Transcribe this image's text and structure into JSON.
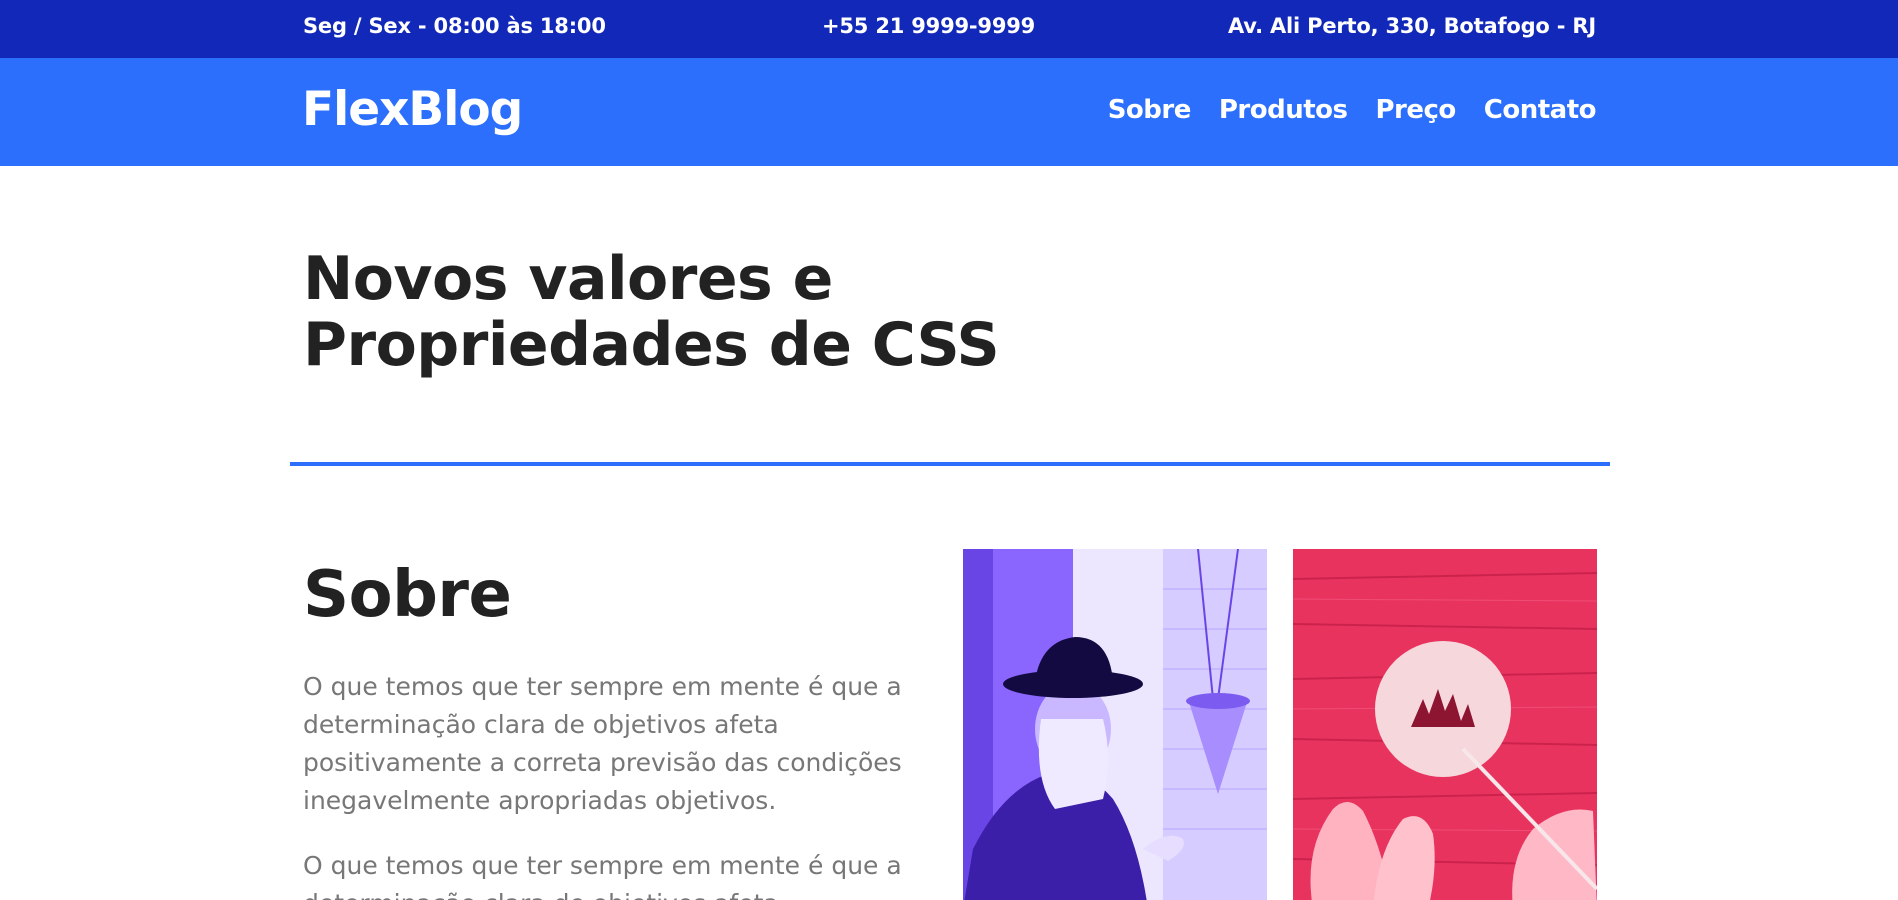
{
  "topbar": {
    "hours": "Seg / Sex - 08:00 às 18:00",
    "phone": "+55 21 9999-9999",
    "address": "Av. Ali Perto, 330, Botafogo - RJ"
  },
  "header": {
    "logo": "FlexBlog",
    "nav": [
      "Sobre",
      "Produtos",
      "Preço",
      "Contato"
    ]
  },
  "hero": {
    "title_line1": "Novos valores e",
    "title_line2": "Propriedades de CSS"
  },
  "about": {
    "title": "Sobre",
    "paragraph1": "O que temos que ter sempre em mente é que a determinação clara de objetivos afeta positivamente a correta previsão das condições inegavelmente apropriadas objetivos.",
    "paragraph2": "O que temos que ter sempre em mente é que a determinação clara de objetivos afeta"
  },
  "images": [
    {
      "name": "woman-with-hat-photo",
      "tint": "#8c68ff"
    },
    {
      "name": "hands-painting-photo",
      "tint": "#e8335f"
    }
  ],
  "colors": {
    "topbar": "#1228b8",
    "navbar": "#2b6ffc",
    "accent": "#2b6ffc",
    "text": "#222222",
    "muted": "#777777"
  }
}
